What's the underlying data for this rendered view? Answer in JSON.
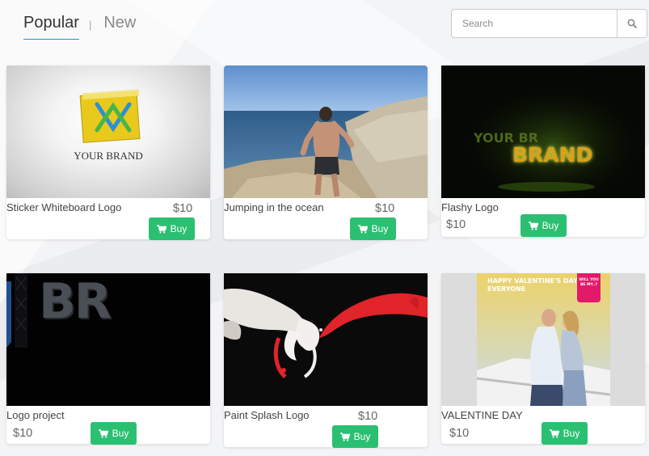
{
  "tabs": [
    {
      "label": "Popular",
      "active": true
    },
    {
      "label": "New",
      "active": false
    }
  ],
  "tab_separator": "|",
  "search": {
    "placeholder": "Search",
    "icon": "search-icon"
  },
  "buy_icon": "cart-icon",
  "items": [
    {
      "title": "Sticker Whiteboard Logo",
      "price": "$10",
      "buy_label": "Buy",
      "thumb_text": "YOUR BRAND"
    },
    {
      "title": "Jumping in the ocean",
      "price": "$10",
      "buy_label": "Buy"
    },
    {
      "title": "Flashy Logo",
      "price": "$10",
      "buy_label": "Buy",
      "thumb_text": "BRAND"
    },
    {
      "title": "Logo project",
      "price": "$10",
      "buy_label": "Buy",
      "thumb_text": "BR"
    },
    {
      "title": "Paint Splash Logo",
      "price": "$10",
      "buy_label": "Buy"
    },
    {
      "title": "VALENTINE DAY",
      "price": "$10",
      "buy_label": "Buy",
      "thumb_text": "HAPPY VALENTINE'S DAY EVERYONE",
      "badge_text": "WILL YOU BE MY..?"
    }
  ]
}
